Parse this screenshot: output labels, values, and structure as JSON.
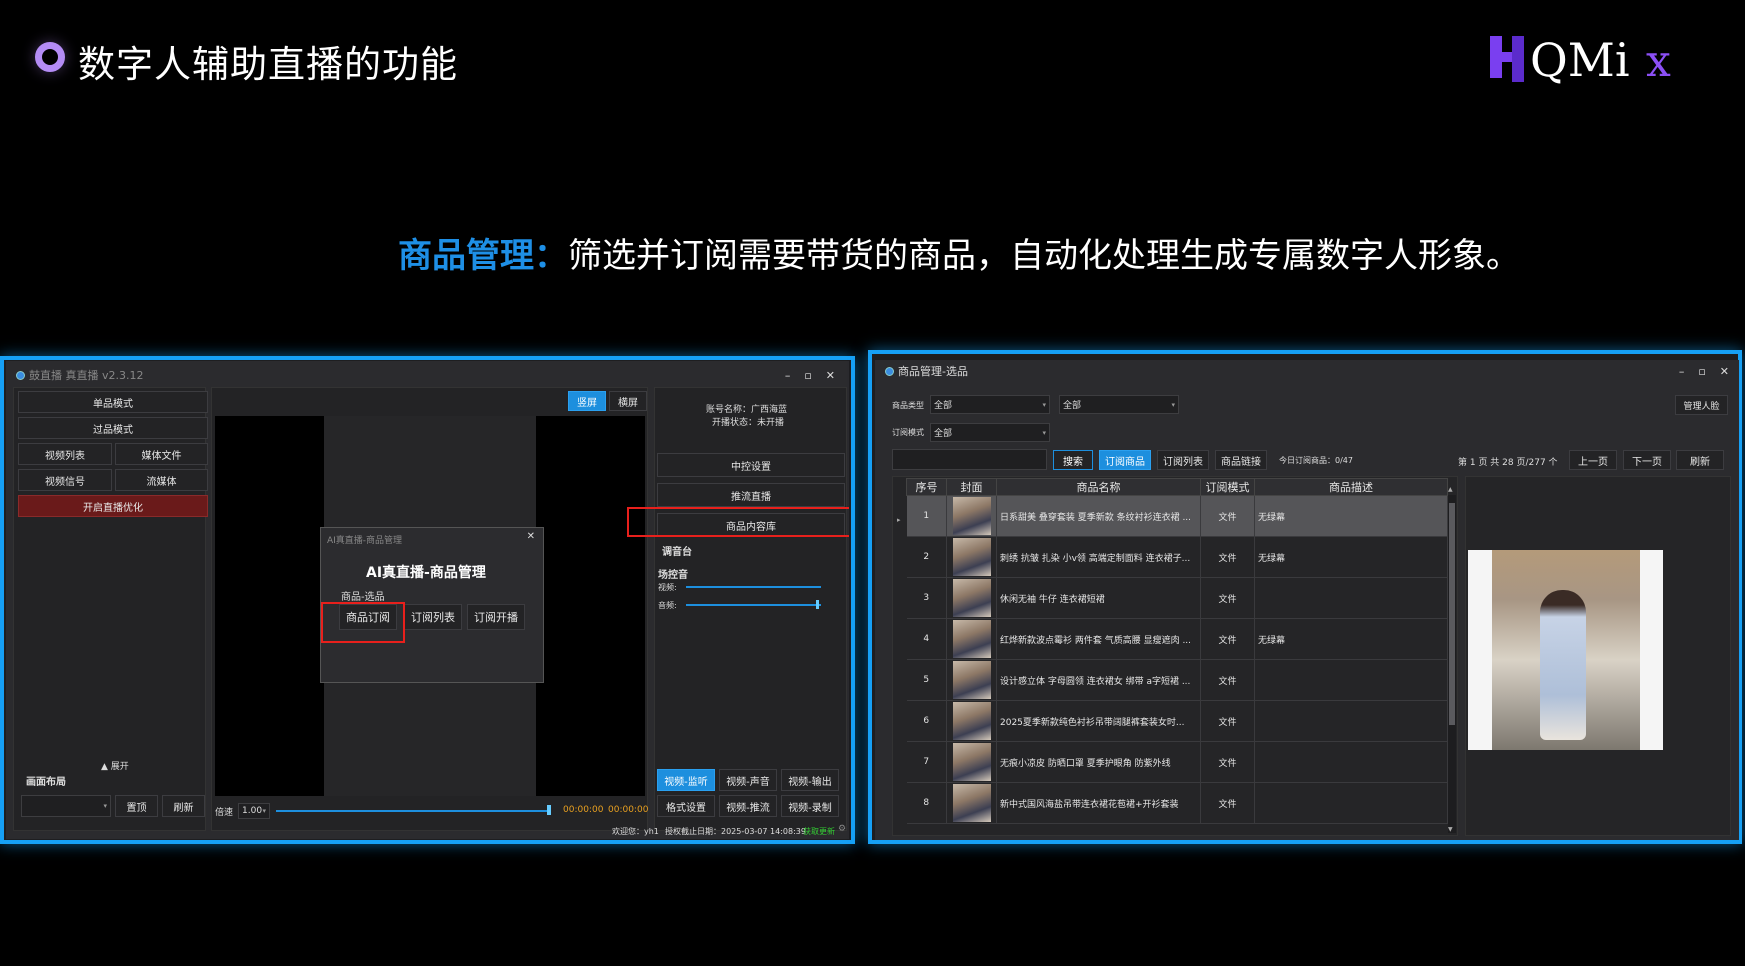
{
  "slide": {
    "title": "数字人辅助直播的功能",
    "subtitle_highlight": "商品管理：",
    "subtitle_rest": "筛选并订阅需要带货的商品，自动化处理生成专属数字人形象。"
  },
  "logo": {
    "text": "QMix",
    "brand_color": "#7a3ff0"
  },
  "colors": {
    "accent": "#16a0f5",
    "highlight": "#1e8fe6",
    "alert": "#e8201c"
  },
  "left_app": {
    "title": "鼓直播 真直播 v2.3.12",
    "left_buttons": [
      "单品模式",
      "过品模式"
    ],
    "grid_buttons": [
      "视频列表",
      "媒体文件",
      "视频信号",
      "流媒体"
    ],
    "optimize_button": "开启直播优化",
    "expand": "▲ 展开",
    "layout_label": "画面布局",
    "top_button": "置顶",
    "refresh_button": "刷新",
    "orientation_tabs": [
      "竖屏",
      "横屏"
    ],
    "speed_label": "倍速",
    "speed_value": "1.00",
    "time_a": "00:00:00",
    "time_b": "00:00:00",
    "account_name": "账号名称：广西海蓝",
    "live_status": "开播状态：未开播",
    "right_buttons": [
      "中控设置",
      "推流直播",
      "商品内容库"
    ],
    "mixer_title": "调音台",
    "field_title": "场控音",
    "video_label": "视频:",
    "audio_label": "音频:",
    "bottom_tabs": [
      "视频-监听",
      "视频-声音",
      "视频-输出",
      "格式设置",
      "视频-推流",
      "视频-录制"
    ],
    "status_bar": {
      "welcome": "欢迎您：yh1",
      "expiry": "授权截止日期：2025-03-07 14:08:39",
      "update": "获取更新"
    },
    "dialog": {
      "titlebar": "AI真直播-商品管理",
      "heading": "AI真直播-商品管理",
      "group": "商品-选品",
      "buttons": [
        "商品订阅",
        "订阅列表",
        "订阅开播"
      ]
    }
  },
  "right_app": {
    "title": "商品管理-选品",
    "filter_type_label": "商品类型",
    "filter_type_value": "全部",
    "filter_type_value2": "全部",
    "filter_sub_label": "订阅模式",
    "filter_sub_value": "全部",
    "manage_face": "管理人脸",
    "search_placeholder": "",
    "buttons": [
      "搜索",
      "订阅商品",
      "订阅列表",
      "商品链接"
    ],
    "today_count": "今日订阅商品：0/47",
    "page_info": "第 1 页 共 28 页/277 个",
    "prev": "上一页",
    "next": "下一页",
    "refresh": "刷新",
    "columns": [
      "序号",
      "封面",
      "商品名称",
      "订阅模式",
      "商品描述"
    ],
    "rows": [
      {
        "no": "1",
        "name": "日系甜美 叠穿套装 夏季新款 条纹衬衫连衣裙 ...",
        "mode": "文件",
        "desc": "无绿幕"
      },
      {
        "no": "2",
        "name": "刺绣 抗皱 扎染 小v领 高端定制面料 连衣裙子...",
        "mode": "文件",
        "desc": "无绿幕"
      },
      {
        "no": "3",
        "name": "休闲无袖 牛仔 连衣裙短裙",
        "mode": "文件",
        "desc": ""
      },
      {
        "no": "4",
        "name": "红烨新款波点霉衫 两件套 气质高腰 显瘦遮肉 ...",
        "mode": "文件",
        "desc": "无绿幕"
      },
      {
        "no": "5",
        "name": "设计感立体 字母圆领 连衣裙女 绑带 a字短裙 ...",
        "mode": "文件",
        "desc": ""
      },
      {
        "no": "6",
        "name": "2025夏季新款纯色衬衫吊带阔腿裤套装女时...",
        "mode": "文件",
        "desc": ""
      },
      {
        "no": "7",
        "name": "无痕小凉皮 防晒口罩 夏季护眼角 防紫外线",
        "mode": "文件",
        "desc": ""
      },
      {
        "no": "8",
        "name": "新中式国风海盐吊带连衣裙花苞裙+开衫套装",
        "mode": "文件",
        "desc": ""
      }
    ]
  }
}
